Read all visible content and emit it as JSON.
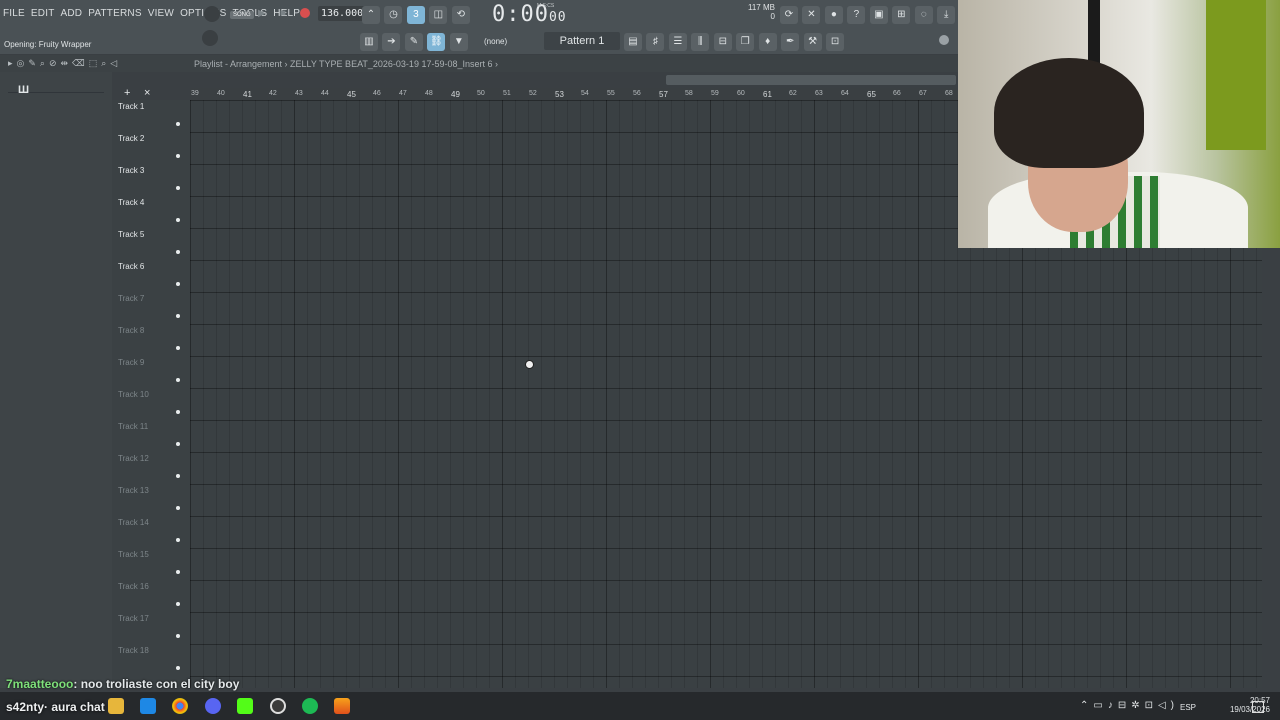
{
  "menu": [
    "FILE",
    "EDIT",
    "ADD",
    "PATTERNS",
    "VIEW",
    "OPTIONS",
    "TOOLS",
    "HELP"
  ],
  "hint": "Opening: Fruity Wrapper",
  "transport": {
    "mode": "SONG",
    "tempo": "136.000",
    "time_main": "0:00",
    "time_sub": "00",
    "time_label": "M:S:CS"
  },
  "memory": {
    "mb": "117 MB",
    "cpu": "0"
  },
  "pattern": {
    "name": "Pattern 1",
    "none": "(none)"
  },
  "breadcrumb": "Playlist - Arrangement › ZELLY TYPE BEAT_2026-03-19 17-59-08_Insert 6 ›",
  "ruler": [
    "39",
    "40",
    "41",
    "42",
    "43",
    "44",
    "45",
    "46",
    "47",
    "48",
    "49",
    "50",
    "51",
    "52",
    "53",
    "54",
    "55",
    "56",
    "57",
    "58",
    "59",
    "60",
    "61",
    "62",
    "63",
    "64",
    "65",
    "66",
    "67",
    "68"
  ],
  "tracks": [
    {
      "name": "Track 1",
      "on": true
    },
    {
      "name": "Track 2",
      "on": true
    },
    {
      "name": "Track 3",
      "on": true
    },
    {
      "name": "Track 4",
      "on": true
    },
    {
      "name": "Track 5",
      "on": true
    },
    {
      "name": "Track 6",
      "on": true
    },
    {
      "name": "Track 7",
      "on": false
    },
    {
      "name": "Track 8",
      "on": false
    },
    {
      "name": "Track 9",
      "on": false
    },
    {
      "name": "Track 10",
      "on": false
    },
    {
      "name": "Track 11",
      "on": false
    },
    {
      "name": "Track 12",
      "on": false
    },
    {
      "name": "Track 13",
      "on": false
    },
    {
      "name": "Track 14",
      "on": false
    },
    {
      "name": "Track 15",
      "on": false
    },
    {
      "name": "Track 16",
      "on": false
    },
    {
      "name": "Track 17",
      "on": false
    },
    {
      "name": "Track 18",
      "on": false
    }
  ],
  "chat": {
    "user": "7maatteooo",
    "message": ": noo troliaste con el city boy"
  },
  "overlay_name": "s42nty· aura chat",
  "taskbar": {
    "lang": "ESP",
    "time": "20:57",
    "date": "19/03/2026"
  }
}
